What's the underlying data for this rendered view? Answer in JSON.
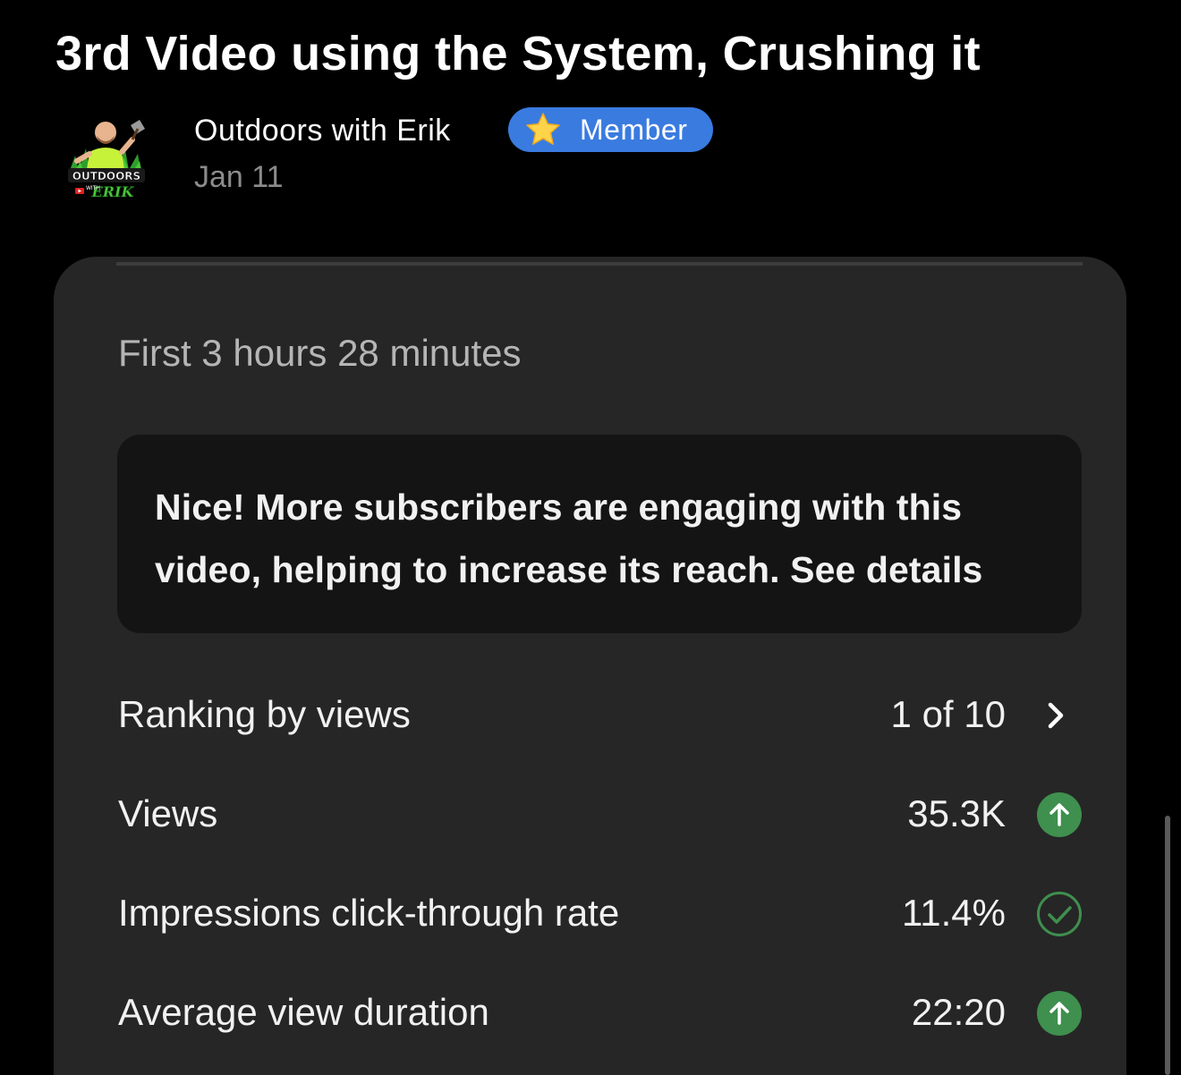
{
  "post": {
    "title": "3rd Video using the System, Crushing it",
    "author": "Outdoors with Erik",
    "badge_label": "Member",
    "date": "Jan 11",
    "avatar_logo_text": "OUTDOORS WITH ERIK"
  },
  "analytics": {
    "period": "First 3 hours 28 minutes",
    "insight": "Nice! More subscribers are engaging with this video, helping to increase its reach. See details",
    "metrics": [
      {
        "label": "Ranking by views",
        "value": "1 of 10",
        "icon": "chevron-right-icon"
      },
      {
        "label": "Views",
        "value": "35.3K",
        "icon": "arrow-up-circle-icon"
      },
      {
        "label": "Impressions click-through rate",
        "value": "11.4%",
        "icon": "check-circle-icon"
      },
      {
        "label": "Average view duration",
        "value": "22:20",
        "icon": "arrow-up-circle-icon"
      }
    ]
  },
  "colors": {
    "background": "#000000",
    "card": "#262626",
    "insight_box": "#141414",
    "badge": "#3a7be0",
    "positive_green": "#3f8f4e",
    "muted_text": "#8b8b8b"
  }
}
